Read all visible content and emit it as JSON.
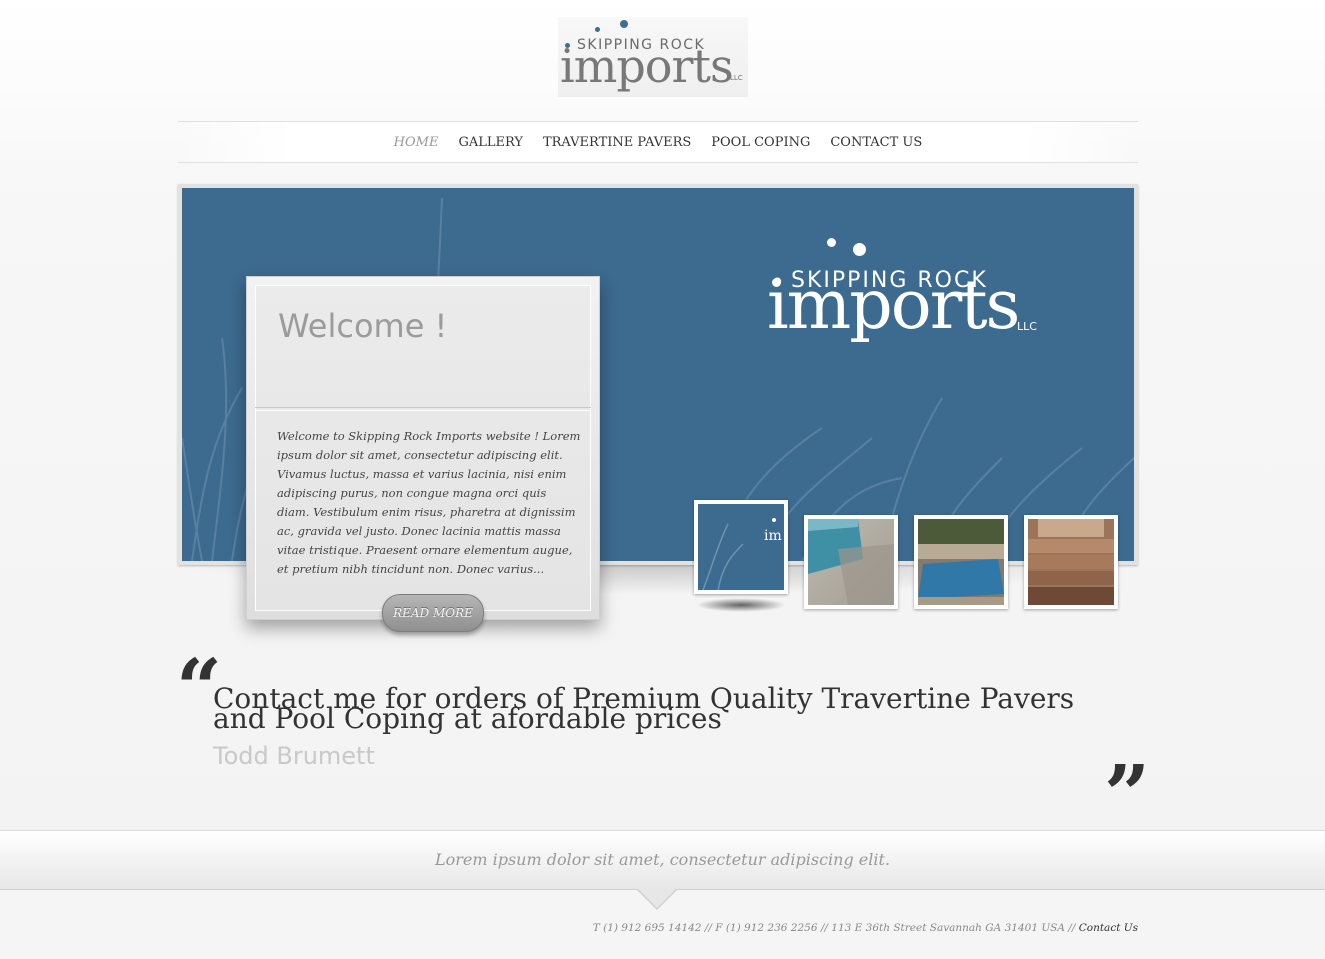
{
  "brand": {
    "name_small": "SKIPPING ROCK",
    "name_large": "imports",
    "suffix": "LLC",
    "color": "#3e6f94"
  },
  "nav": {
    "items": [
      {
        "label": "HOME",
        "active": true
      },
      {
        "label": "GALLERY"
      },
      {
        "label": "TRAVERTINE PAVERS"
      },
      {
        "label": "POOL COPING"
      },
      {
        "label": "CONTACT US"
      }
    ]
  },
  "slider": {
    "background": "#3d6a8f",
    "welcome_title": "Welcome !",
    "welcome_text": "Welcome to Skipping Rock Imports website ! Lorem ipsum dolor sit amet, consectetur adipiscing elit. Vivamus luctus, massa et varius lacinia, nisi enim adipiscing purus, non congue magna orci quis diam. Vestibulum enim risus, pharetra at dignissim ac, gravida vel justo. Donec lacinia mattis massa vitae tristique. Praesent ornare elementum augue, et pretium nibh tincidunt non. Donec varius...",
    "read_more": "READ MORE",
    "thumbnails": [
      {
        "name": "thumb-logo-slide",
        "active": true
      },
      {
        "name": "thumb-pool-steps"
      },
      {
        "name": "thumb-pool-view"
      },
      {
        "name": "thumb-paver-steps"
      }
    ]
  },
  "quote": {
    "open_mark": "“",
    "close_mark": "”",
    "text": "Contact me for orders of Premium Quality Travertine Pavers and Pool Coping at afordable prices",
    "author": "Todd Brumett"
  },
  "footer": {
    "tagline": "Lorem ipsum dolor sit amet, consectetur adipiscing elit.",
    "contact_info": "T (1) 912 695 14142 // F (1) 912 236 2256 // 113 E 36th Street Savannah GA 31401 USA // ",
    "contact_link": "Contact Us"
  }
}
